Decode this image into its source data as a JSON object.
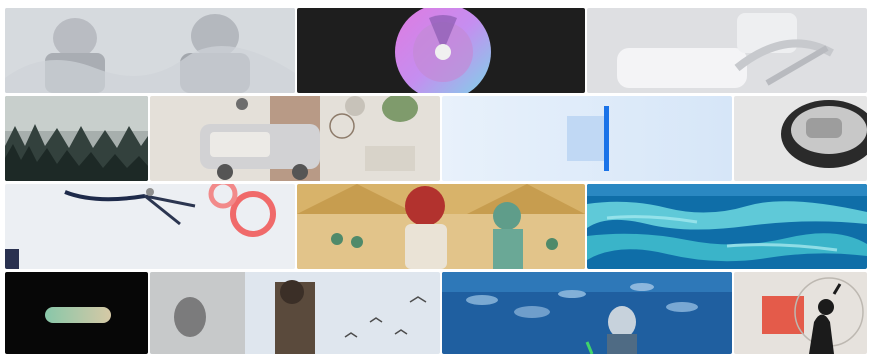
{
  "gallery": {
    "tiles": [
      {
        "name": "tile-astronauts-sketch",
        "icon": "astronaut-illustration"
      },
      {
        "name": "tile-gradient-dial",
        "icon": "dial-disc"
      },
      {
        "name": "tile-white-chair",
        "icon": "chair-render"
      },
      {
        "name": "tile-misty-forest",
        "icon": "forest-photo"
      },
      {
        "name": "tile-cart-illustration",
        "icon": "vehicle-illustration"
      },
      {
        "name": "tile-blue-blur",
        "icon": "abstract-blue"
      },
      {
        "name": "tile-button-closeup",
        "icon": "button-render"
      },
      {
        "name": "tile-scissors-tape",
        "icon": "scissors-photo"
      },
      {
        "name": "tile-tent-illustration",
        "icon": "people-illustration"
      },
      {
        "name": "tile-coral-reef",
        "icon": "reef-aerial-photo"
      },
      {
        "name": "tile-black-pill",
        "icon": "pill-shape"
      },
      {
        "name": "tile-bird-window",
        "icon": "birds-photo"
      },
      {
        "name": "tile-aquarium",
        "icon": "aquarium-photo"
      },
      {
        "name": "tile-silhouette-collage",
        "icon": "collage-photo"
      }
    ]
  },
  "colors": {
    "background": "#ffffff",
    "accent_blue": "#1a73e8"
  }
}
